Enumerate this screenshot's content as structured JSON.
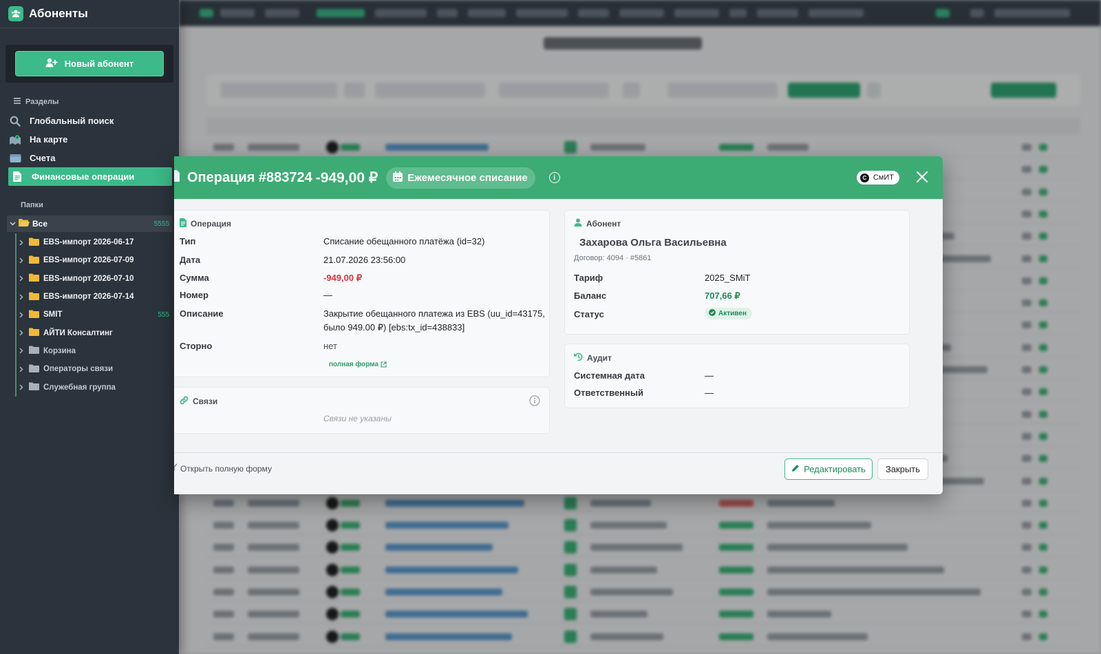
{
  "sidebar": {
    "title": "Абоненты",
    "new_button": "Новый абонент",
    "sections_label": "Разделы",
    "nav": [
      {
        "label": "Глобальный поиск",
        "icon": "search-icon"
      },
      {
        "label": "На карте",
        "icon": "map-icon"
      },
      {
        "label": "Счета",
        "icon": "wallet-icon"
      },
      {
        "label": "Финансовые операции",
        "icon": "document-icon",
        "active": true
      }
    ],
    "folders_label": "Папки",
    "folder_all": {
      "label": "Все",
      "count": "5555"
    },
    "folders": [
      {
        "label": "EBS-импорт 2026-06-17",
        "count": ""
      },
      {
        "label": "EBS-импорт 2026-07-09",
        "count": ""
      },
      {
        "label": "EBS-импорт 2026-07-10",
        "count": ""
      },
      {
        "label": "EBS-импорт 2026-07-14",
        "count": ""
      },
      {
        "label": "SMIT",
        "count": "555"
      },
      {
        "label": "АЙТИ Консалтинг",
        "count": ""
      },
      {
        "label": "Корзина",
        "count": ""
      },
      {
        "label": "Операторы связи",
        "count": ""
      },
      {
        "label": "Служебная группа",
        "count": ""
      }
    ]
  },
  "modal": {
    "title": "Операция #883724",
    "amount": "-949,00 ₽",
    "type_pill": "Ежемесячное списание",
    "provider": "СмИТ",
    "operation": {
      "heading": "Операция",
      "type_label": "Тип",
      "type_value": "Списание обещанного платёжа (id=32)",
      "date_label": "Дата",
      "date_value": "21.07.2026 23:56:00",
      "sum_label": "Сумма",
      "sum_value": "-949,00 ₽",
      "number_label": "Номер",
      "number_value": "—",
      "desc_label": "Описание",
      "desc_value_line1": "Закрытие обещанного платежа из EBS (uu_id=43175,",
      "desc_value_line2": "было 949.00 ₽) [ebs:tx_id=438833]",
      "storno_label": "Сторно",
      "storno_value": "нет",
      "full_form_link": "полная форма"
    },
    "links": {
      "heading": "Связи",
      "empty": "Связи не указаны"
    },
    "subscriber": {
      "heading": "Абонент",
      "name": "Захарова Ольга Васильевна",
      "contract": "Договор: 4094 · #5861",
      "tariff_label": "Тариф",
      "tariff_value": "2025_SMiT",
      "balance_label": "Баланс",
      "balance_value": "707,66 ₽",
      "status_label": "Статус",
      "status_value": "Активен"
    },
    "audit": {
      "heading": "Аудит",
      "sysdate_label": "Системная дата",
      "sysdate_value": "—",
      "responsible_label": "Ответственный",
      "responsible_value": "—"
    },
    "footer": {
      "open_full": "Открыть полную форму",
      "edit": "Редактировать",
      "close": "Закрыть"
    }
  },
  "colors": {
    "accent": "#3cba89",
    "header": "#3dab74",
    "negative": "#d63440",
    "positive": "#1f8a5a",
    "sidebar_bg": "#2b333c"
  }
}
